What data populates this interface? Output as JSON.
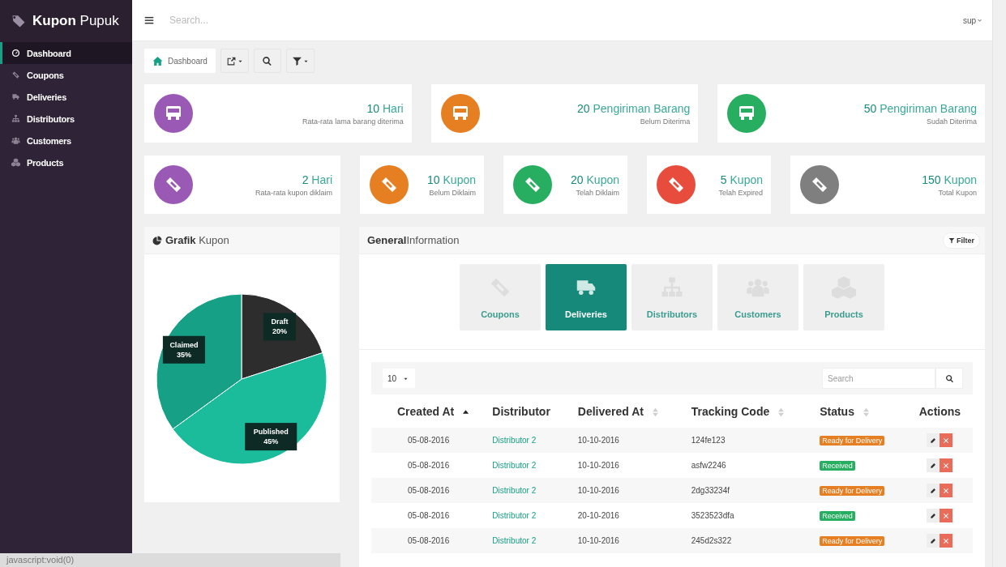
{
  "sidebar": {
    "brand_bold": "Kupon",
    "brand_rest": "Pupuk",
    "items": [
      {
        "label": "Dashboard",
        "kind": "gauge",
        "selected": true
      },
      {
        "label": "Coupons",
        "kind": "ticket",
        "selected": false
      },
      {
        "label": "Deliveries",
        "kind": "truck",
        "selected": false
      },
      {
        "label": "Distributors",
        "kind": "sitemap",
        "selected": false
      },
      {
        "label": "Customers",
        "kind": "users",
        "selected": false
      },
      {
        "label": "Products",
        "kind": "cubes",
        "selected": false
      }
    ]
  },
  "topbar": {
    "search_placeholder": "Search...",
    "user": "sup"
  },
  "breadcrumb": "Dashboard",
  "stats_row1": [
    {
      "value": "10",
      "unit": "Hari",
      "caption": "Rata-rata lama barang diterima",
      "kind": "truck",
      "color": "#9b59b6"
    },
    {
      "value": "20",
      "unit": "Pengiriman Barang",
      "caption": "Belum Diterima",
      "kind": "truck",
      "color": "#e67e22"
    },
    {
      "value": "50",
      "unit": "Pengiriman Barang",
      "caption": "Sudah Diterima",
      "kind": "truck",
      "color": "#27ae60"
    }
  ],
  "stats_row2": [
    {
      "value": "2",
      "unit": "Hari",
      "caption": "Rata-rata kupon diklaim",
      "kind": "ticket",
      "color": "#9b59b6"
    },
    {
      "value": "10",
      "unit": "Kupon",
      "caption": "Belum Diklaim",
      "kind": "ticket",
      "color": "#e67e22"
    },
    {
      "value": "20",
      "unit": "Kupon",
      "caption": "Telah Diklaim",
      "kind": "ticket",
      "color": "#27ae60"
    },
    {
      "value": "5",
      "unit": "Kupon",
      "caption": "Telah Expired",
      "kind": "ticket",
      "color": "#e74c3c"
    },
    {
      "value": "150",
      "unit": "Kupon",
      "caption": "Total Kupon",
      "kind": "ticket",
      "color": "#7f7f7f"
    }
  ],
  "grafik": {
    "title_bold": "Grafik",
    "title_rest": "Kupon",
    "chart_data": {
      "type": "pie",
      "categories": [
        "Draft",
        "Published",
        "Claimed"
      ],
      "values": [
        20,
        45,
        35
      ],
      "colors": [
        "#2d2d2d",
        "#1abc9c",
        "#16a085"
      ],
      "data_labels": true,
      "value_labels": [
        "20%",
        "45%",
        "35%"
      ]
    }
  },
  "general": {
    "title_bold": "General",
    "title_rest": "Information",
    "filter": "Filter",
    "tabs": [
      {
        "label": "Coupons",
        "kind": "ticket",
        "selected": false
      },
      {
        "label": "Deliveries",
        "kind": "truck",
        "selected": true
      },
      {
        "label": "Distributors",
        "kind": "sitemap",
        "selected": false
      },
      {
        "label": "Customers",
        "kind": "users",
        "selected": false
      },
      {
        "label": "Products",
        "kind": "cubes",
        "selected": false
      }
    ],
    "page_size": "10",
    "search_placeholder": "Search",
    "columns": [
      {
        "label": "Created At",
        "sortable": true,
        "sorted": true
      },
      {
        "label": "Distributor",
        "sortable": false,
        "sorted": false
      },
      {
        "label": "Delivered At",
        "sortable": true,
        "sorted": false
      },
      {
        "label": "Tracking Code",
        "sortable": true,
        "sorted": false
      },
      {
        "label": "Status",
        "sortable": true,
        "sorted": false
      },
      {
        "label": "Actions",
        "sortable": false,
        "sorted": false
      }
    ],
    "rows": [
      {
        "created_at": "05-08-2016",
        "distributor": "Distributor 2",
        "delivered_at": "10-10-2016",
        "tracking_code": "124fe123",
        "status": "Ready for Delivery",
        "color": "#e67e22"
      },
      {
        "created_at": "05-08-2016",
        "distributor": "Distributor 2",
        "delivered_at": "10-10-2016",
        "tracking_code": "asfw2246",
        "status": "Received",
        "color": "#27ae60"
      },
      {
        "created_at": "05-08-2016",
        "distributor": "Distributor 2",
        "delivered_at": "10-10-2016",
        "tracking_code": "2dg33234f",
        "status": "Ready for Delivery",
        "color": "#e67e22"
      },
      {
        "created_at": "05-08-2016",
        "distributor": "Distributor 2",
        "delivered_at": "20-10-2016",
        "tracking_code": "3523523dfa",
        "status": "Received",
        "color": "#27ae60"
      },
      {
        "created_at": "05-08-2016",
        "distributor": "Distributor 2",
        "delivered_at": "10-10-2016",
        "tracking_code": "245d2s322",
        "status": "Ready for Delivery",
        "color": "#e67e22"
      }
    ]
  },
  "status_bar": "javascript:void(0)"
}
